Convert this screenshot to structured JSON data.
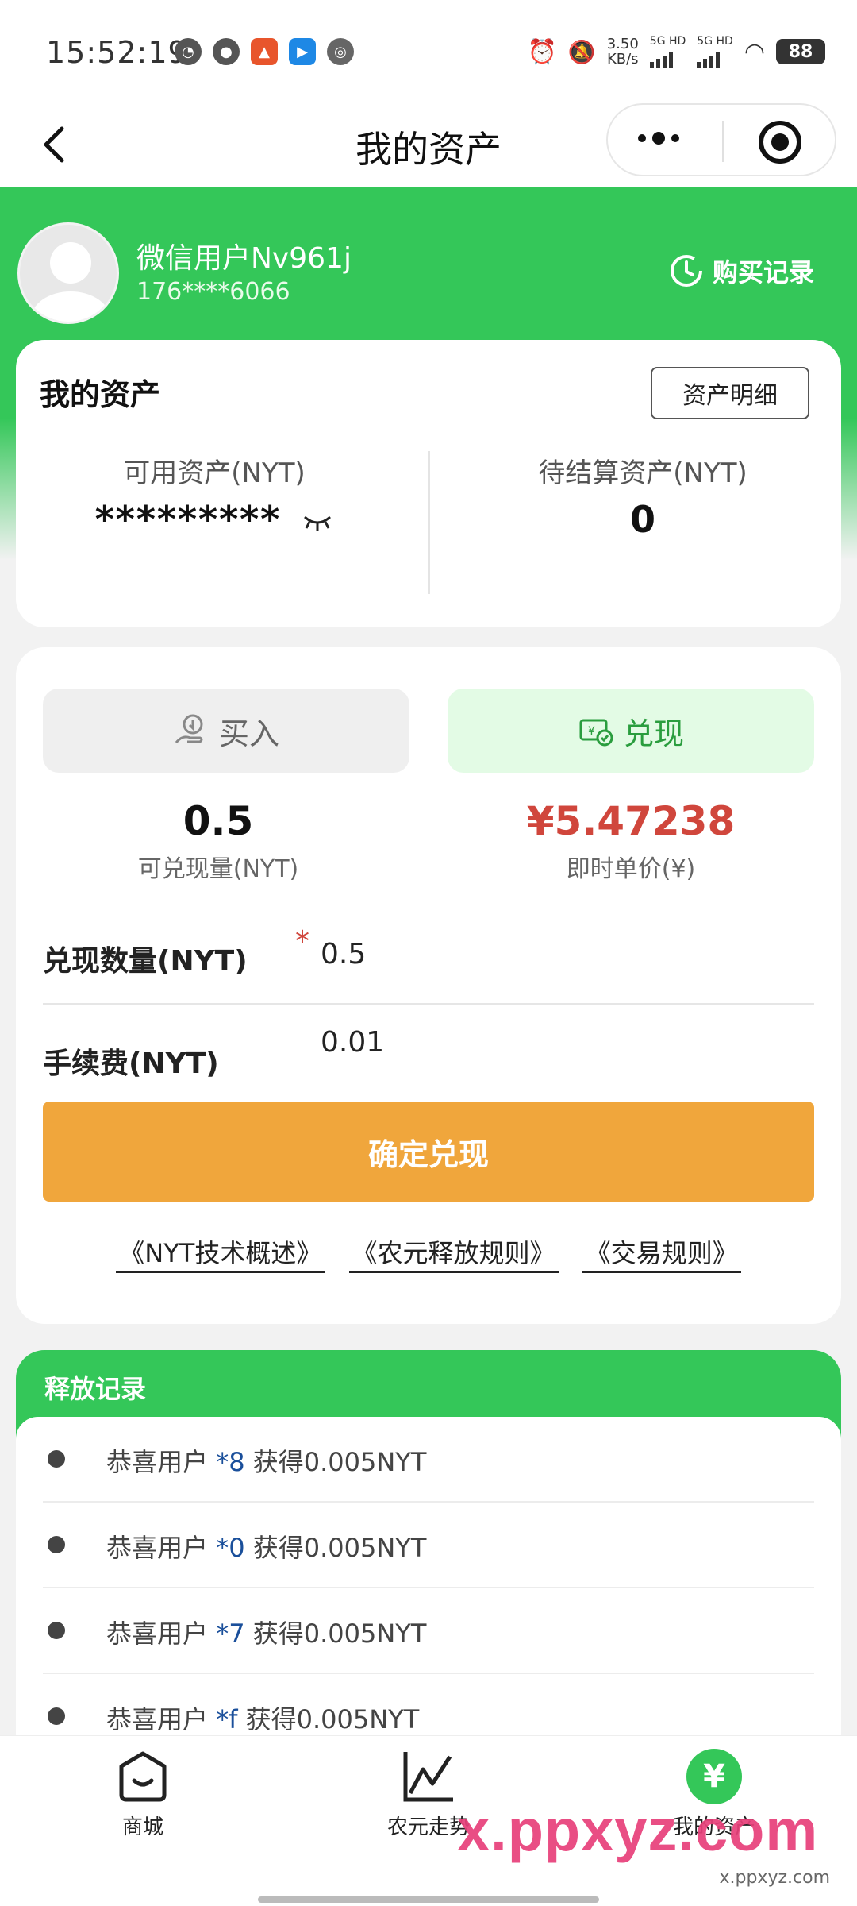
{
  "status_bar": {
    "time": "15:52:19",
    "net_speed_value": "3.50",
    "net_speed_unit": "KB/s",
    "signal1": "5G HD",
    "signal2": "5G HD",
    "battery": "88"
  },
  "nav": {
    "title": "我的资产"
  },
  "user": {
    "name": "微信用户Nv961j",
    "phone": "176****6066",
    "purchase_record": "购买记录"
  },
  "assets": {
    "title": "我的资产",
    "detail_button": "资产明细",
    "available_label": "可用资产(NYT)",
    "available_value": "*********",
    "pending_label": "待结算资产(NYT)",
    "pending_value": "0"
  },
  "trade": {
    "buy_tab": "买入",
    "cash_tab": "兑现",
    "cashable_amount": "0.5",
    "cashable_label": "可兑现量(NYT)",
    "unit_price": "¥5.47238",
    "unit_price_label": "即时单价(¥)",
    "quantity_label": "兑现数量(NYT)",
    "required_mark": "*",
    "quantity_value": "0.5",
    "fee_label": "手续费(NYT)",
    "fee_value": "0.01",
    "confirm_button": "确定兑现",
    "links": [
      "《NYT技术概述》",
      "《农元释放规则》",
      "《交易规则》"
    ]
  },
  "release": {
    "title": "释放记录",
    "items": [
      {
        "prefix": "恭喜用户",
        "uid": "*8",
        "text": "获得0.005NYT"
      },
      {
        "prefix": "恭喜用户",
        "uid": "*0",
        "text": "获得0.005NYT"
      },
      {
        "prefix": "恭喜用户",
        "uid": "*7",
        "text": "获得0.005NYT"
      },
      {
        "prefix": "恭喜用户",
        "uid": "*f",
        "text": "获得0.005NYT"
      }
    ]
  },
  "tabbar": {
    "shop": "商城",
    "trend": "农元走势",
    "mine": "我的资产",
    "mine_icon": "¥"
  },
  "watermark": {
    "main": "x.ppxyz.com",
    "sub": "x.ppxyz.com"
  },
  "colors": {
    "brand_green": "#34c759",
    "confirm_orange": "#f0a63c",
    "price_red": "#d0463c"
  }
}
